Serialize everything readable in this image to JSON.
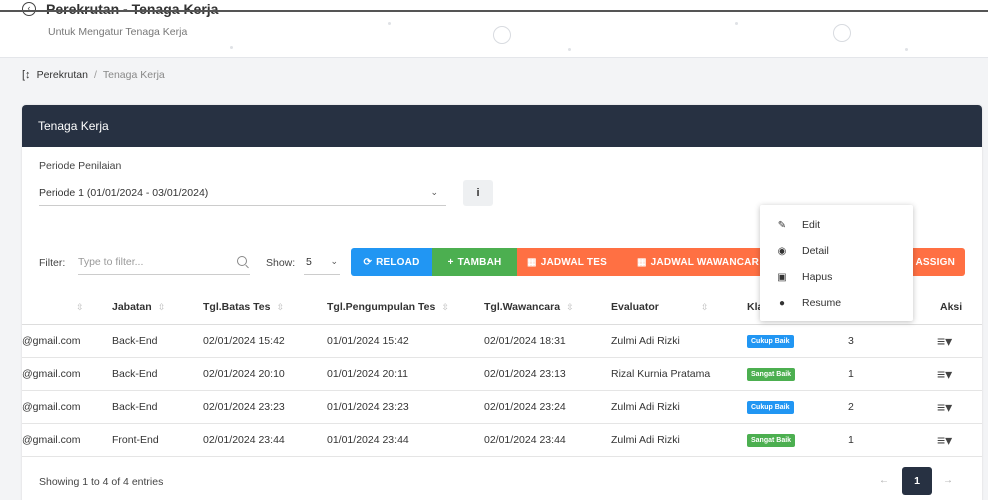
{
  "header": {
    "title": "Perekrutan - Tenaga Kerja",
    "subtitle": "Untuk Mengatur Tenaga Kerja"
  },
  "breadcrumb": {
    "items": [
      "Perekrutan",
      "Tenaga Kerja"
    ],
    "separator": "/"
  },
  "card": {
    "title": "Tenaga Kerja",
    "periode_label": "Periode Penilaian",
    "periode_value": "Periode 1 (01/01/2024 - 03/01/2024)",
    "info_label": "i"
  },
  "toolbar": {
    "filter_label": "Filter:",
    "filter_placeholder": "Type to filter...",
    "show_label": "Show:",
    "show_value": "5",
    "buttons": {
      "reload": "RELOAD",
      "tambah": "TAMBAH",
      "jadwal_tes": "JADWAL TES",
      "jadwal_wawancara": "JADWAL WAWANCAR",
      "assign": "ASSIGN"
    }
  },
  "table": {
    "columns": {
      "email_sort": "",
      "jabatan": "Jabatan",
      "tgl_batas_tes": "Tgl.Batas Tes",
      "tgl_pengumpulan_tes": "Tgl.Pengumpulan Tes",
      "tgl_wawancara": "Tgl.Wawancara",
      "evaluator": "Evaluator",
      "klasifikasi": "Kla",
      "aksi": "Aksi"
    },
    "rows": [
      {
        "email": "@gmail.com",
        "jabatan": "Back-End",
        "tgl_batas": "02/01/2024 15:42",
        "tgl_pengumpulan": "01/01/2024 15:42",
        "tgl_wawancara": "02/01/2024 18:31",
        "evaluator": "Zulmi Adi Rizki",
        "badge": "Cukup Baik",
        "badge_color": "#2196f3",
        "nilai": "3"
      },
      {
        "email": "@gmail.com",
        "jabatan": "Back-End",
        "tgl_batas": "02/01/2024 20:10",
        "tgl_pengumpulan": "01/01/2024 20:11",
        "tgl_wawancara": "02/01/2024 23:13",
        "evaluator": "Rizal Kurnia Pratama",
        "badge": "Sangat Baik",
        "badge_color": "#4caf50",
        "nilai": "1"
      },
      {
        "email": "@gmail.com",
        "jabatan": "Back-End",
        "tgl_batas": "02/01/2024 23:23",
        "tgl_pengumpulan": "01/01/2024 23:23",
        "tgl_wawancara": "02/01/2024 23:24",
        "evaluator": "Zulmi Adi Rizki",
        "badge": "Cukup Baik",
        "badge_color": "#2196f3",
        "nilai": "2"
      },
      {
        "email": "@gmail.com",
        "jabatan": "Front-End",
        "tgl_batas": "02/01/2024 23:44",
        "tgl_pengumpulan": "01/01/2024 23:44",
        "tgl_wawancara": "02/01/2024 23:44",
        "evaluator": "Zulmi Adi Rizki",
        "badge": "Sangat Baik",
        "badge_color": "#4caf50",
        "nilai": "1"
      }
    ]
  },
  "footer": {
    "info": "Showing 1 to 4 of 4 entries",
    "current_page": "1",
    "prev": "←",
    "next": "→"
  },
  "dropdown": {
    "items": [
      {
        "label": "Edit",
        "icon": "edit-icon"
      },
      {
        "label": "Detail",
        "icon": "eye-icon"
      },
      {
        "label": "Hapus",
        "icon": "trash-icon"
      },
      {
        "label": "Resume",
        "icon": "user-icon"
      }
    ]
  },
  "colors": {
    "card_header": "#273142",
    "reload": "#2196f3",
    "tambah": "#4caf50",
    "orange": "#ff7043"
  }
}
